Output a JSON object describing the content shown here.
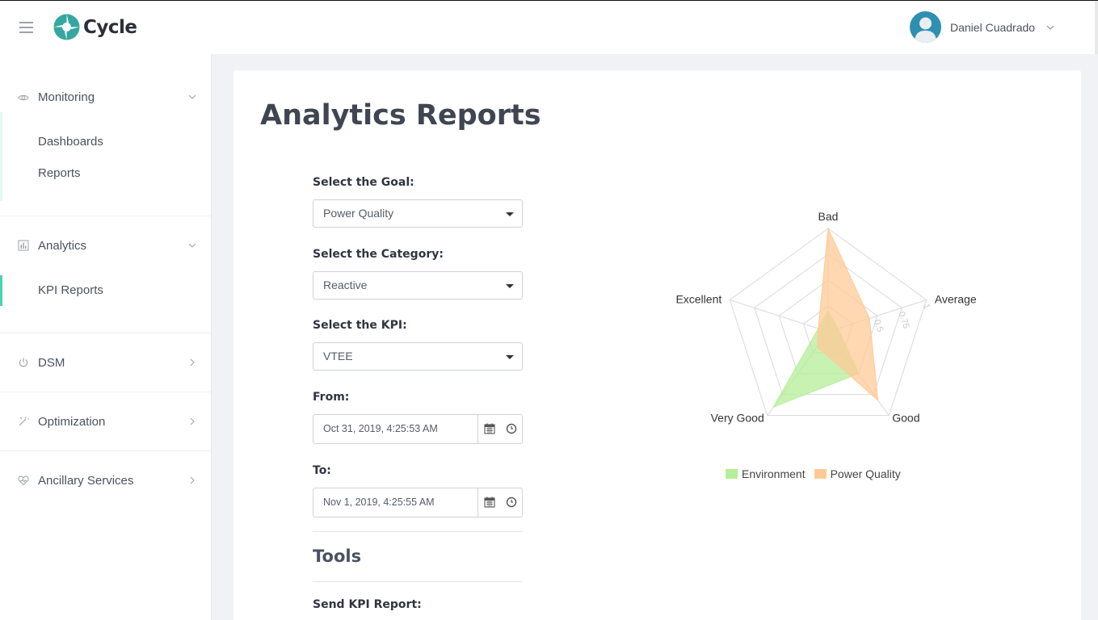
{
  "app": {
    "brand": "Cycle"
  },
  "header": {
    "user_name": "Daniel Cuadrado"
  },
  "sidebar": {
    "monitoring": {
      "label": "Monitoring",
      "items": [
        "Dashboards",
        "Reports"
      ]
    },
    "analytics": {
      "label": "Analytics",
      "items": [
        "KPI Reports"
      ]
    },
    "dsm": {
      "label": "DSM"
    },
    "optimization": {
      "label": "Optimization"
    },
    "ancillary": {
      "label": "Ancillary Services"
    }
  },
  "main": {
    "title": "Analytics Reports",
    "goal": {
      "label": "Select the Goal:",
      "value": "Power Quality"
    },
    "category": {
      "label": "Select the Category:",
      "value": "Reactive"
    },
    "kpi": {
      "label": "Select the KPI:",
      "value": "VTEE"
    },
    "from": {
      "label": "From:",
      "value": "Oct 31, 2019, 4:25:53 AM"
    },
    "to": {
      "label": "To:",
      "value": "Nov 1, 2019, 4:25:55 AM"
    },
    "tools_title": "Tools",
    "send_label": "Send KPI Report:"
  },
  "colors": {
    "accent": "#49d3b0",
    "environment": "#b6ee98",
    "power_quality": "#ffc996"
  },
  "chart_data": {
    "type": "radar",
    "axes": [
      "Bad",
      "Average",
      "Good",
      "Very Good",
      "Excellent"
    ],
    "scale_ticks": [
      "0.5",
      "0.75",
      "1"
    ],
    "range": [
      0,
      1
    ],
    "series": [
      {
        "name": "Environment",
        "values": [
          0.2,
          0.1,
          0.5,
          0.9,
          0.1
        ],
        "color": "#b6ee98"
      },
      {
        "name": "Power Quality",
        "values": [
          1.0,
          0.42,
          0.82,
          0.18,
          0.1
        ],
        "color": "#ffc996"
      }
    ]
  }
}
